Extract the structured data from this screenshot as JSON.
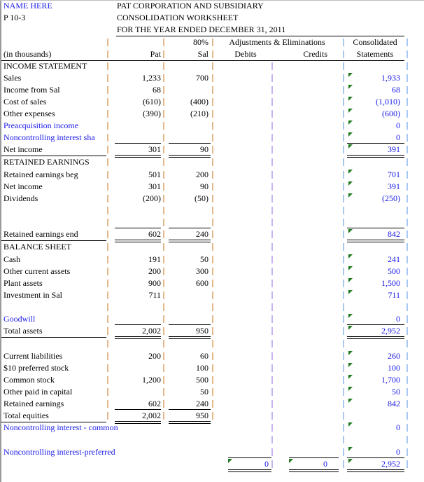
{
  "header": {
    "name": "NAME HERE",
    "problem": "P 10-3",
    "title_line1": "PAT CORPORATION AND SUBSIDIARY",
    "title_line2": "CONSOLIDATION WORKSHEET",
    "title_line3": "FOR THE YEAR ENDED DECEMBER 31, 2011"
  },
  "columns": {
    "units": "(in thousands)",
    "pat": "Pat",
    "sal_pct": "80%",
    "sal": "Sal",
    "adjustments": "Adjustments & Eliminations",
    "debits": "Debits",
    "credits": "Credits",
    "consolidated_line1": "Consolidated",
    "consolidated_line2": "Statements"
  },
  "colors": {
    "input_text": "#1a1ae6",
    "formula_marker": "#1d7a1d"
  },
  "rows": [
    {
      "label": "INCOME STATEMENT",
      "pat": "",
      "sal": "",
      "con": ""
    },
    {
      "label": "Sales",
      "pat": "1,233",
      "sal": "700",
      "con": "1,933"
    },
    {
      "label": "Income from Sal",
      "pat": "68",
      "sal": "",
      "con": "68"
    },
    {
      "label": "Cost of sales",
      "pat": "(610)",
      "sal": "(400)",
      "con": "(1,010)"
    },
    {
      "label": "Other expenses",
      "pat": "(390)",
      "sal": "(210)",
      "con": "(600)"
    },
    {
      "label": "Preacquisition income",
      "pat": "",
      "sal": "",
      "con": "0"
    },
    {
      "label": "Noncontrolling interest sha",
      "pat": "",
      "sal": "",
      "con": "0"
    },
    {
      "label": "Net income",
      "pat": "301",
      "sal": "90",
      "con": "391"
    },
    {
      "label": "RETAINED EARNINGS",
      "pat": "",
      "sal": "",
      "con": ""
    },
    {
      "label": "Retained earnings beg",
      "pat": "501",
      "sal": "200",
      "con": "701"
    },
    {
      "label": "Net income",
      "pat": "301",
      "sal": "90",
      "con": "391"
    },
    {
      "label": "Dividends",
      "pat": "(200)",
      "sal": "(50)",
      "con": "(250)"
    },
    {
      "label": "",
      "pat": "",
      "sal": "",
      "con": ""
    },
    {
      "label": "",
      "pat": "",
      "sal": "",
      "con": ""
    },
    {
      "label": "Retained earnings end",
      "pat": "602",
      "sal": "240",
      "con": "842"
    },
    {
      "label": "BALANCE SHEET",
      "pat": "",
      "sal": "",
      "con": ""
    },
    {
      "label": "Cash",
      "pat": "191",
      "sal": "50",
      "con": "241"
    },
    {
      "label": "Other current assets",
      "pat": "200",
      "sal": "300",
      "con": "500"
    },
    {
      "label": "Plant assets",
      "pat": "900",
      "sal": "600",
      "con": "1,500"
    },
    {
      "label": "Investment in Sal",
      "pat": "711",
      "sal": "",
      "con": "711"
    },
    {
      "label": "",
      "pat": "",
      "sal": "",
      "con": ""
    },
    {
      "label": "Goodwill",
      "pat": "",
      "sal": "",
      "con": "0"
    },
    {
      "label": "Total assets",
      "pat": "2,002",
      "sal": "950",
      "con": "2,952"
    },
    {
      "label": "",
      "pat": "",
      "sal": "",
      "con": ""
    },
    {
      "label": "Current liabilities",
      "pat": "200",
      "sal": "60",
      "con": "260"
    },
    {
      "label": "$10 preferred stock",
      "pat": "",
      "sal": "100",
      "con": "100"
    },
    {
      "label": "Common stock",
      "pat": "1,200",
      "sal": "500",
      "con": "1,700"
    },
    {
      "label": "Other paid in capital",
      "pat": "",
      "sal": "50",
      "con": "50"
    },
    {
      "label": "Retained earnings",
      "pat": "602",
      "sal": "240",
      "con": "842"
    },
    {
      "label": "Total equities",
      "pat": "2,002",
      "sal": "950",
      "con": ""
    },
    {
      "label": "Noncontrolling interest - common",
      "pat": "",
      "sal": "",
      "con": "0"
    },
    {
      "label": "",
      "pat": "",
      "sal": "",
      "con": ""
    },
    {
      "label": "Noncontrolling interest-preferred",
      "pat": "",
      "sal": "",
      "con": "0"
    },
    {
      "label": "",
      "pat": "",
      "sal": "",
      "deb": "0",
      "cre": "0",
      "con": "2,952"
    }
  ]
}
